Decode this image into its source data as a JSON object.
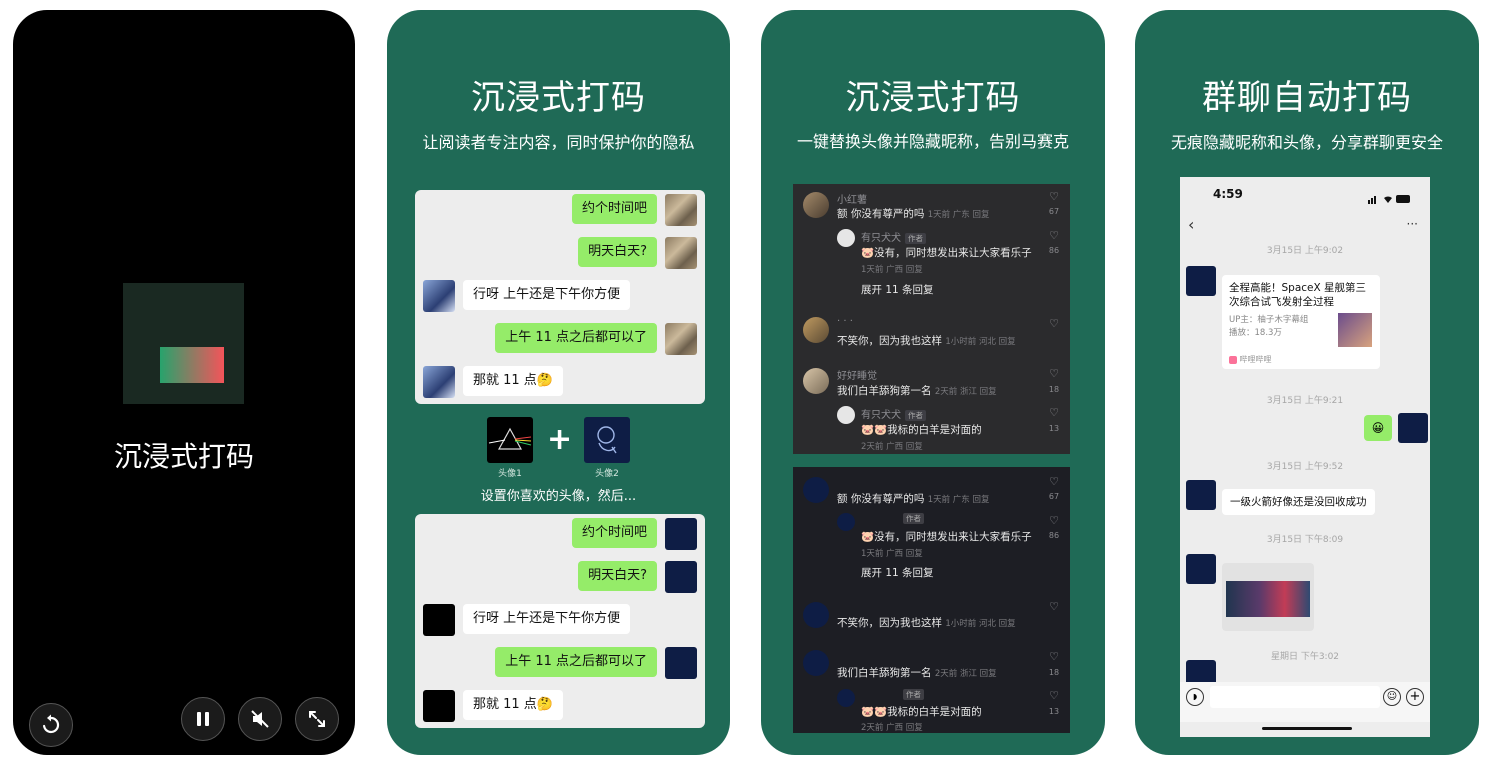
{
  "colors": {
    "panel_green": "#1f6a56",
    "bubble_green": "#95ec69",
    "accent_red": "#f4545a",
    "accent_green": "#27a36c"
  },
  "panel1": {
    "video_title": "沉浸式打码"
  },
  "panel2": {
    "title": "沉浸式打码",
    "subtitle": "让阅读者专注内容，同时保护你的隐私",
    "messages": [
      {
        "side": "right",
        "text": "约个时间吧"
      },
      {
        "side": "right",
        "text": "明天白天?"
      },
      {
        "side": "left",
        "text": "行呀 上午还是下午你方便"
      },
      {
        "side": "right",
        "text": "上午 11 点之后都可以了"
      },
      {
        "side": "left",
        "text": "那就 11 点🤔"
      }
    ],
    "avatar1_label": "头像1",
    "avatar2_label": "头像2",
    "plus": "+",
    "caption": "设置你喜欢的头像，然后..."
  },
  "panel3": {
    "title": "沉浸式打码",
    "subtitle": "一键替换头像并隐藏昵称，告别马赛克",
    "top": {
      "c1_name": "小红薯",
      "c1_text": "额 你没有尊严的吗",
      "c1_meta": "1天前 广东 回复",
      "c1_count": "67",
      "r1_name": "有只犬犬",
      "author_tag": "作者",
      "r1_text": "🐷没有，同时想发出来让大家看乐子",
      "r1_meta": "1天前 广西 回复",
      "r1_count": "86",
      "expand": "展开 11 条回复",
      "c2_name": "· · ·",
      "c2_text": "不笑你，因为我也这样",
      "c2_meta": "1小时前 河北 回复",
      "c3_name": "好好睡觉",
      "c3_text": "我们白羊舔狗第一名",
      "c3_meta": "2天前 浙江 回复",
      "c3_count": "18",
      "r2_name": "有只犬犬",
      "r2_text": "🐷🐷我标的白羊是对面的",
      "r2_meta": "2天前 广西 回复",
      "r2_count": "13"
    },
    "bottom": {
      "c1_text": "额 你没有尊严的吗",
      "c1_meta": "1天前 广东 回复",
      "c1_count": "67",
      "author_tag": "作者",
      "r1_text": "🐷没有，同时想发出来让大家看乐子",
      "r1_meta": "1天前 广西 回复",
      "r1_count": "86",
      "expand": "展开 11 条回复",
      "c2_text": "不笑你，因为我也这样",
      "c2_meta": "1小时前 河北 回复",
      "c3_text": "我们白羊舔狗第一名",
      "c3_meta": "2天前 浙江 回复",
      "c3_count": "18",
      "r2_text": "🐷🐷我标的白羊是对面的",
      "r2_meta": "2天前 广西 回复",
      "r2_count": "13"
    }
  },
  "panel4": {
    "title": "群聊自动打码",
    "subtitle": "无痕隐藏昵称和头像，分享群聊更安全",
    "status_time": "4:59",
    "more": "···",
    "ts1": "3月15日 上午9:02",
    "card_title": "全程高能！SpaceX 星舰第三次综合试飞发射全过程",
    "card_up": "UP主：柚子木字幕组",
    "card_plays": "播放：18.3万",
    "card_source": "哔哩哔哩",
    "ts2": "3月15日 上午9:21",
    "emoji": "😀",
    "ts3": "3月15日 上午9:52",
    "msg": "一级火箭好像还是没回收成功",
    "ts4": "3月15日 下午8:09",
    "ts5": "星期日 下午3:02"
  }
}
